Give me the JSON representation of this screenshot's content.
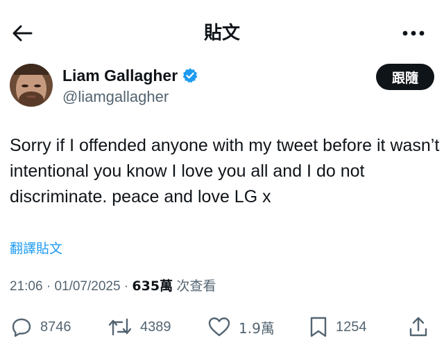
{
  "header": {
    "title": "貼文",
    "back_icon": "arrow-left-icon",
    "more_icon": "more-horizontal-icon"
  },
  "author": {
    "display_name": "Liam Gallagher",
    "handle": "@liamgallagher",
    "verified_badge": "verified-badge-icon",
    "follow_label": "跟隨"
  },
  "tweet": {
    "text": "Sorry if I offended anyone with my tweet before it wasn’t intentional you know I love you all and I do not discriminate. peace and love LG x",
    "translate_label": "翻譯貼文"
  },
  "meta": {
    "time": "21:06",
    "date": "01/07/2025",
    "separator": "·",
    "views": "635萬",
    "views_label": "次查看"
  },
  "actions": {
    "replies": "8746",
    "reposts": "4389",
    "likes": "1.9萬",
    "bookmarks": "1254"
  },
  "colors": {
    "text": "#0f1419",
    "secondary": "#536471",
    "link": "#1d9bf0",
    "verified": "#1d9bf0",
    "follow_bg": "#0f1419"
  }
}
